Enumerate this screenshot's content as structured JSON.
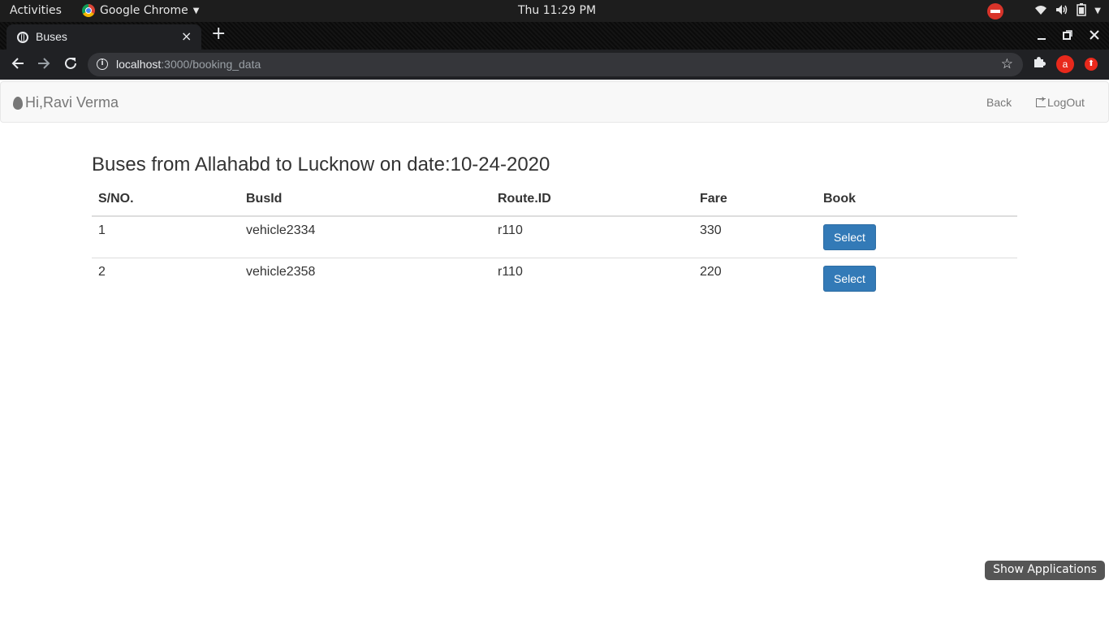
{
  "system_bar": {
    "activities": "Activities",
    "app_name": "Google Chrome",
    "clock": "Thu 11:29 PM"
  },
  "browser": {
    "tab_title": "Buses",
    "tab_close": "×",
    "new_tab": "+",
    "url_host": "localhost",
    "url_rest": ":3000/booking_data",
    "extension_avatar": "a"
  },
  "navbar": {
    "brand": "Hi,Ravi Verma",
    "back_label": "Back",
    "logout_label": "LogOut"
  },
  "main": {
    "heading": "Buses from Allahabd to Lucknow on date:10-24-2020",
    "table": {
      "headers": [
        "S/NO.",
        "BusId",
        "Route.ID",
        "Fare",
        "Book"
      ],
      "rows": [
        {
          "sno": "1",
          "bus_id": "vehicle2334",
          "route_id": "r110",
          "fare": "330",
          "action": "Select"
        },
        {
          "sno": "2",
          "bus_id": "vehicle2358",
          "route_id": "r110",
          "fare": "220",
          "action": "Select"
        }
      ]
    }
  },
  "dock": {
    "show_applications": "Show Applications"
  },
  "colors": {
    "primary_button": "#337ab7",
    "navbar_bg": "#f8f8f8",
    "text": "#333333"
  }
}
